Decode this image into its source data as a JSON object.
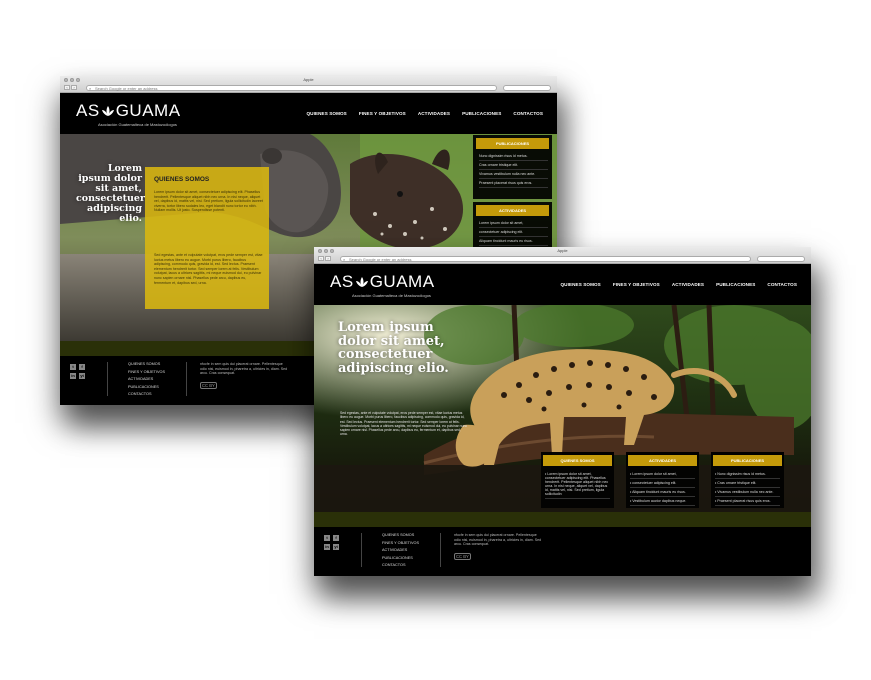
{
  "browser": {
    "window_title": "Apple",
    "url_placeholder": "Search Google or enter an address",
    "back_label": "‹",
    "forward_label": "›"
  },
  "site": {
    "logo_text_left": "AS",
    "logo_text_right": "GUAMA",
    "logo_tagline": "Asociación Guatemalteca de Mastozoólogos",
    "menu": [
      "QUIENES SOMOS",
      "FINES Y OBJETIVOS",
      "ACTIVIDADES",
      "PUBLICACIONES",
      "CONTACTOS"
    ]
  },
  "page1": {
    "hero_title": "Lorem ipsum dolor sit amet, consectetuer adipiscing elio.",
    "box_title": "QUIENES SOMOS",
    "box_para_1": "Lorem ipsum dolor sit amet, consectetuer adipiscing elit. Phasellus hendrerit. Pellentesque aliquet nibh nec urna. In nisi neque, aliquet vel, dapibus id, mattis vel, nisi. Sed pretium, ligula sollicitudin laoreet viverra, tortor libero sodales leo, eget blandit nunc tortor eu nibh. Nullam mollis. Ut justo. Suspendisse potenti.",
    "box_para_2": "Sed egestas, ante et vulputate volutpat, eros pede semper est, vitae luctus metus libero eu augue. Morbi purus libero, faucibus adipiscing, commodo quis, gravida id, est. Sed lectus. Praesent elementum hendrerit tortor. Sed semper lorem at felis. Vestibulum volutpat, lacus a ultrices sagittis, mi neque euismod dui, eu pulvinar nunc sapien ornare nisl. Phasellus pede arcu, dapibus eu, fermentum et, dapibus sed, urna.",
    "side_publicaciones_title": "PUBLICACIONES",
    "side_publicaciones_items": [
      "Nunc dignissim risus id metus.",
      "Cras ornare tristique elit.",
      "Vivamus vestibulum nulla nec ante.",
      "Praesent placerat risus quis eros."
    ],
    "side_actividades_title": "ACTIVIDADES",
    "side_actividades_items": [
      "Lorem ipsum dolor sit amet,",
      "consectetuer adipiscing elit.",
      "Aliquam tincidunt mauris eu risus."
    ]
  },
  "page2": {
    "hero_title": "Lorem ipsum dolor sit amet, consectetuer adipiscing elio.",
    "hero_para": "Sed egestas, ante et vulputate volutpat, eros pede semper est, vitae luctus metus libero eu augue. Morbi purus libero, faucibus adipiscing, commodo quis, gravida id, est. Sed lectus. Praesent elementum hendrerit tortor. Sed semper lorem at felis. Vestibulum volutpat, lacus a ultrices sagittis, mi neque euismod dui, eu pulvinar nunc sapien ornare nisl. Phasellus pede arcu, dapibus eu, fermentum et, dapibus sed, urna.",
    "cards": [
      {
        "title": "QUIENES SOMOS",
        "items": [
          "Lorem ipsum dolor sit amet, consectetuer adipiscing elit. Phasellus hendrerit. Pellentesque aliquet nibh nec urna. In nisi neque, aliquet vel, dapibus id, mattis vel, nisi. Sed pretium, ligula sollicitudin"
        ]
      },
      {
        "title": "ACTIVIDADES",
        "items": [
          "Lorem ipsum dolor sit amet,",
          "consectetuer adipiscing elit.",
          "Aliquam tincidunt mauris eu risus.",
          "Vestibulum auctor dapibus neque."
        ]
      },
      {
        "title": "PUBLICACIONES",
        "items": [
          "Nunc dignissim risus id metus.",
          "Cras ornare tristique elit.",
          "Vivamus vestibulum nulla nec ante.",
          "Praesent placerat risus quis eros."
        ]
      }
    ]
  },
  "footer": {
    "social": [
      "t",
      "f",
      "in",
      "yt"
    ],
    "links": [
      "QUIENES SOMOS",
      "FINES Y OBJETIVOS",
      "ACTIVIDADES",
      "PUBLICACIONES",
      "CONTACTOS"
    ],
    "text": "nfocfe in sem quis dui placerat ornare. Pellentesque odio nisi, euismod in, pharetra a, ultricies in, diam. Sed arcu. Cras consequat.",
    "license": "CC BY"
  },
  "colors": {
    "accent_gold": "#c49a0a",
    "box_yellow": "#d9b710",
    "band_olive": "#2a3008",
    "background": "#000000"
  }
}
